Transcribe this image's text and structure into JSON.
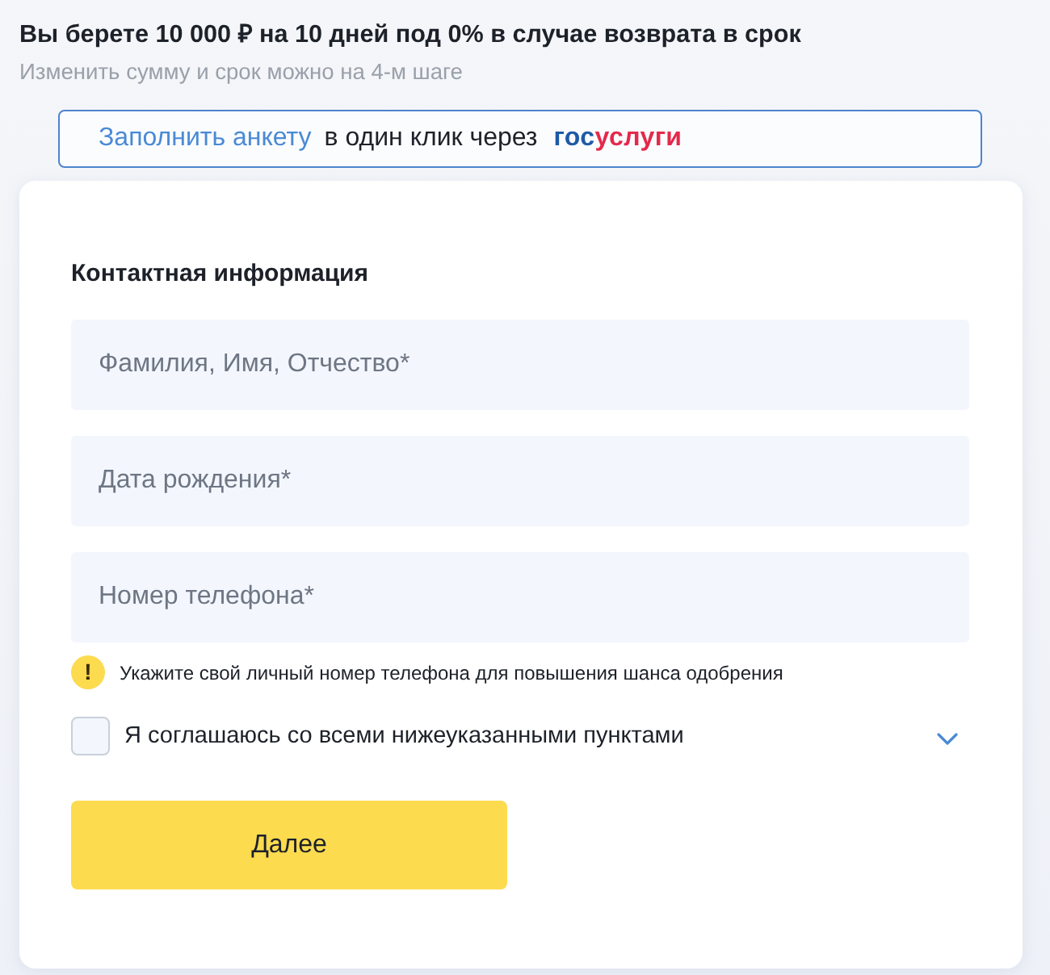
{
  "header": {
    "title": "Вы берете 10 000 ₽ на 10 дней под 0% в случае возврата в срок",
    "subtitle": "Изменить сумму и срок можно на 4-м шаге"
  },
  "gosuslugi_banner": {
    "link": "Заполнить анкету",
    "text": "в один клик через",
    "logo": [
      {
        "text": "гос",
        "color": "#1d5aa6"
      },
      {
        "text": "услуги",
        "color": "#e5294b"
      }
    ]
  },
  "form": {
    "heading": "Контактная информация",
    "fields": [
      {
        "placeholder": "Фамилия, Имя, Отчество*"
      },
      {
        "placeholder": "Дата рождения*"
      },
      {
        "placeholder": "Номер телефона*"
      }
    ],
    "hint": {
      "icon": "!",
      "text": "Укажите свой личный номер телефона для повышения шанса одобрения"
    },
    "agreement": {
      "label": "Я соглашаюсь со всеми нижеуказанными пунктами",
      "checked": false,
      "expanded": false
    },
    "submit": "Далее"
  }
}
